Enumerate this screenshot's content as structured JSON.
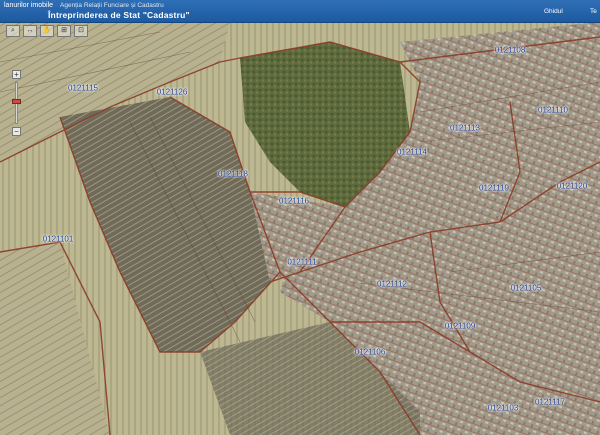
{
  "header": {
    "left_text": "lanurilor imobile",
    "agency": "Agenția Relații Funciare și Cadastru",
    "title": "Întreprinderea de Stat \"Cadastru\"",
    "right_link_1": "Ghidul",
    "right_link_2": "Te"
  },
  "toolbar": {
    "buttons": [
      "⌕",
      "↔",
      "✋",
      "⊞",
      "⊡"
    ]
  },
  "zoom": {
    "in": "+",
    "out": "−",
    "level_fraction": 0.55
  },
  "parcel_labels": {
    "p1": "0121115",
    "p2": "0121126",
    "p3": "0121108",
    "p4": "0121110",
    "p5": "0121113",
    "p6": "0121114",
    "p7": "0121118",
    "p8": "0121119",
    "p9": "0121120",
    "p10": "0121101",
    "p11": "0121116",
    "p12": "0121111",
    "p13": "0121112",
    "p14": "0121105",
    "p15": "0121109",
    "p16": "0121106",
    "p17": "0121117",
    "p18": "0121103"
  },
  "colors": {
    "header": "#2366ad",
    "parcel_lines": "#8b3a26",
    "label_text": "#1c3c8e",
    "fields": "#b8b48e",
    "forest": "#5b6a3c",
    "urban": "#9a9387"
  }
}
